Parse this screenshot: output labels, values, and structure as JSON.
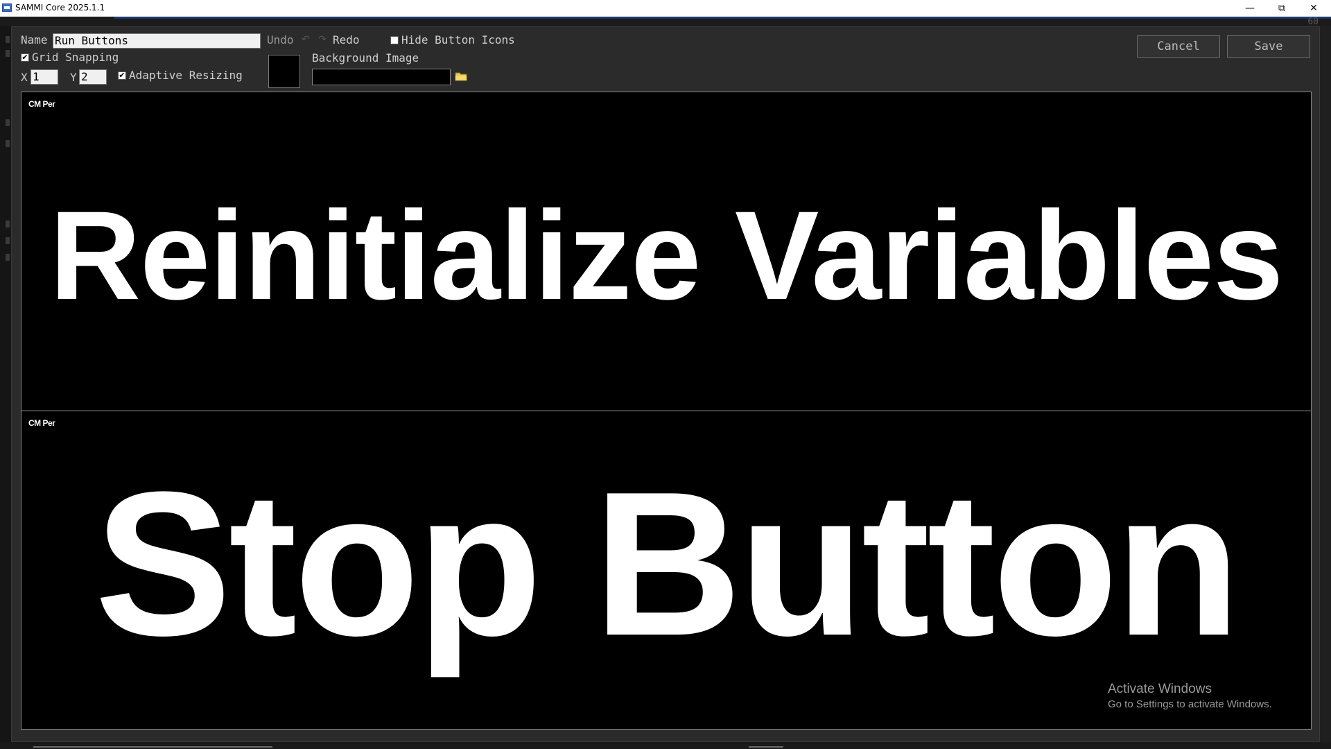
{
  "window": {
    "title": "SAMMI Core 2025.1.1",
    "min_glyph": "—",
    "max_glyph": "⧉",
    "close_glyph": "✕"
  },
  "background": {
    "counter": "60"
  },
  "toolbar": {
    "name_label": "Name",
    "name_value": "Run Buttons",
    "undo_label": "Undo",
    "redo_label": "Redo",
    "undo_icon": "↶",
    "redo_icon": "↷",
    "hide_icons_label": "Hide Button Icons",
    "hide_icons_checked": false,
    "grid_snapping_label": "Grid Snapping",
    "grid_snapping_checked": true,
    "x_label": "X",
    "x_value": "1",
    "y_label": "Y",
    "y_value": "2",
    "adaptive_resizing_label": "Adaptive Resizing",
    "adaptive_resizing_checked": true,
    "background_image_label": "Background Image",
    "background_image_value": "",
    "background_color": "#000000",
    "cancel_label": "Cancel",
    "save_label": "Save",
    "check_glyph": "✔"
  },
  "buttons": [
    {
      "badge": "CM Per",
      "text": "Reinitialize Variables"
    },
    {
      "badge": "CM Per",
      "text": "Stop Button"
    }
  ],
  "watermark": {
    "line1": "Activate Windows",
    "line2": "Go to Settings to activate Windows."
  },
  "colors": {
    "dialog_bg": "#2b2b2b",
    "canvas_bg": "#000000",
    "button_text": "#ffffff",
    "accent_blue": "#1b3a70"
  }
}
